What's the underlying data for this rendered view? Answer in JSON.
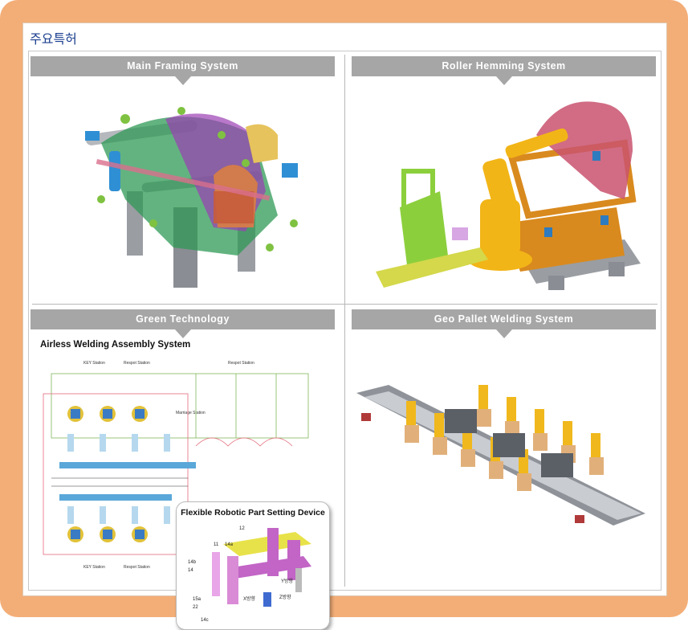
{
  "page": {
    "title": "주요특허"
  },
  "cards": [
    {
      "label": "Main Framing System"
    },
    {
      "label": "Roller Hemming System"
    },
    {
      "label": "Green Technology",
      "subtitle": "Airless Welding Assembly System",
      "callout_title": "Flexible Robotic Part Setting Device",
      "station_labels": [
        "KEY Station",
        "Respot Station",
        "Respot Station",
        "Marriage Station",
        "KEY Station",
        "Respot Station"
      ],
      "part_numbers": [
        "12",
        "11",
        "14a",
        "14b",
        "14",
        "15a",
        "22",
        "14c",
        "X방향",
        "Y방향",
        "Z방향"
      ]
    },
    {
      "label": "Geo Pallet Welding System"
    }
  ],
  "colors": {
    "frame": "#f3ae78",
    "banner": "#a6a6a6",
    "title": "#1b3f8f"
  }
}
